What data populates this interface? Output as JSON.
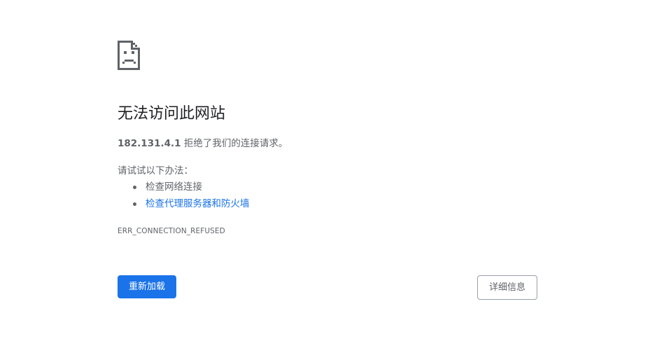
{
  "error": {
    "title": "无法访问此网站",
    "host": "182.131.4.1",
    "message": " 拒绝了我们的连接请求。",
    "suggestions_title": "请试试以下办法：",
    "suggestions": [
      {
        "label": "检查网络连接",
        "is_link": false
      },
      {
        "label": "检查代理服务器和防火墙",
        "is_link": true
      }
    ],
    "code": "ERR_CONNECTION_REFUSED"
  },
  "buttons": {
    "reload": "重新加载",
    "details": "详细信息"
  },
  "icon": "sad-page-icon",
  "colors": {
    "accent": "#1a73e8",
    "text": "#5f6368",
    "title": "#202124"
  }
}
